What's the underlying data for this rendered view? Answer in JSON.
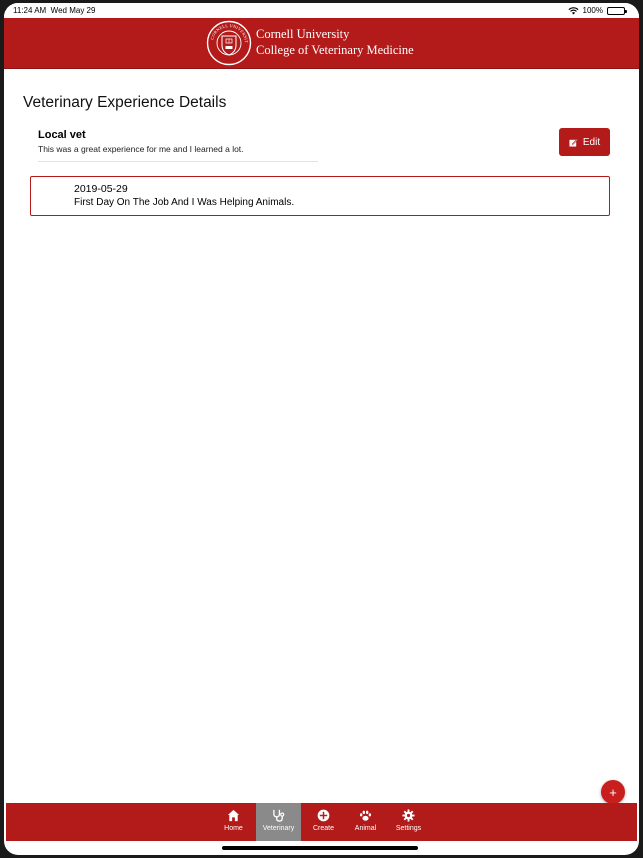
{
  "status_bar": {
    "time": "11:24 AM",
    "date": "Wed May 29",
    "battery": "100%",
    "wifi_icon": "wifi-icon",
    "battery_icon": "battery-icon"
  },
  "header": {
    "line1": "Cornell University",
    "line2": "College of Veterinary Medicine",
    "seal_icon": "cornell-seal-icon",
    "seal_ring_text": "CORNELL UNIVERSITY · FOUNDED A.D. 1865",
    "color": "#b31b1b"
  },
  "page": {
    "title": "Veterinary Experience Details"
  },
  "experience": {
    "title": "Local vet",
    "description": "This was a great experience for me and I learned a lot.",
    "edit_label": "Edit",
    "edit_icon": "edit-icon"
  },
  "entries": [
    {
      "date": "2019-05-29",
      "note": "First Day On The Job And I Was Helping Animals."
    }
  ],
  "fab": {
    "label": "+",
    "icon": "plus-icon"
  },
  "tabs": [
    {
      "label": "Home",
      "icon": "home-icon",
      "active": false
    },
    {
      "label": "Veterinary",
      "icon": "stethoscope-icon",
      "active": true
    },
    {
      "label": "Create",
      "icon": "plus-circle-icon",
      "active": false
    },
    {
      "label": "Animal",
      "icon": "paw-icon",
      "active": false
    },
    {
      "label": "Settings",
      "icon": "gear-icon",
      "active": false
    }
  ],
  "colors": {
    "brand_red": "#b31b1b",
    "tab_active": "#8a8a8a"
  }
}
